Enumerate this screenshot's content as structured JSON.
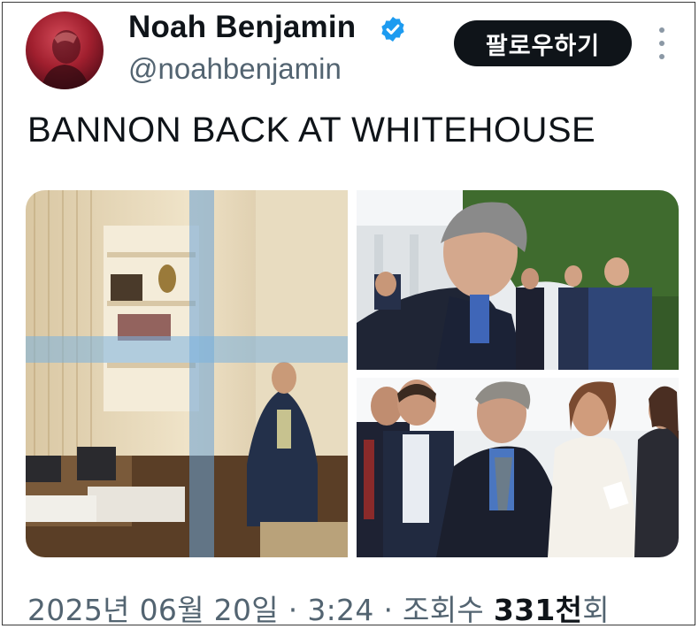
{
  "user": {
    "display_name": "Noah Benjamin",
    "handle": "@noahbenjamin",
    "verified_color": "#1d9bf0"
  },
  "actions": {
    "follow_label": "팔로우하기",
    "more_icon": "more-vertical-icon"
  },
  "tweet": {
    "text": "BANNON BACK AT WHITEHOUSE",
    "date": "2025년 06월 20일",
    "separator": "·",
    "time": "3:24",
    "views_label": "조회수",
    "views_value": "331천",
    "views_suffix": "회"
  },
  "media": {
    "count": 3,
    "items": [
      "oval-office-window-photo",
      "bannon-rose-garden-photo",
      "bannon-crowd-photo"
    ]
  },
  "colors": {
    "text_primary": "#0f1419",
    "text_secondary": "#536471",
    "follow_bg": "#0f1419",
    "follow_text": "#ffffff"
  }
}
